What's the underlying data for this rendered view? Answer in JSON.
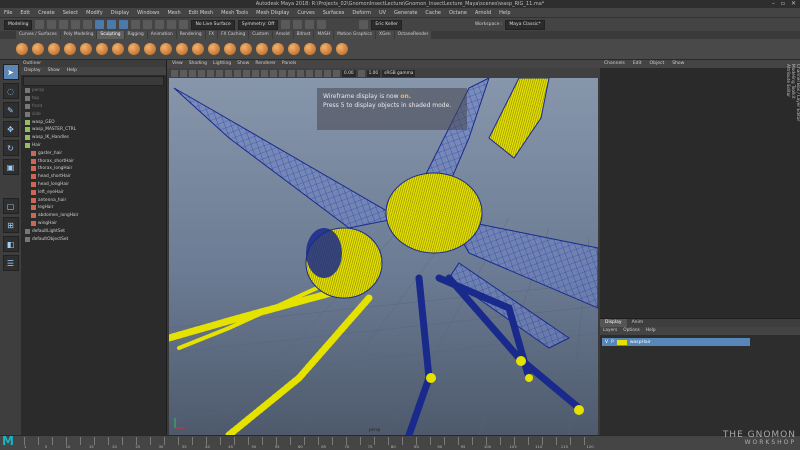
{
  "window": {
    "title": "Autodesk Maya 2018: R:\\Projects_02\\GnomonInsectLecture\\Gnomon_InsectLecture_Maya\\scenes\\wasp_RIG_11.ma*"
  },
  "menu": [
    "File",
    "Edit",
    "Create",
    "Select",
    "Modify",
    "Display",
    "Windows",
    "Mesh",
    "Edit Mesh",
    "Mesh Tools",
    "Mesh Display",
    "Curves",
    "Surfaces",
    "Deform",
    "UV",
    "Generate",
    "Cache",
    "Octane",
    "Arnold",
    "Help"
  ],
  "status": {
    "mode": "Modeling",
    "live_surface": "No Live Surface",
    "symmetry": "Symmetry: Off",
    "user": "Eric Keller",
    "workspace_label": "Workspace :",
    "workspace": "Maya Classic*"
  },
  "shelf_tabs": [
    "Curves / Surfaces",
    "Poly Modeling",
    "Sculpting",
    "Rigging",
    "Animation",
    "Rendering",
    "FX",
    "FX Caching",
    "Custom",
    "Arnold",
    "Bifrost",
    "MASH",
    "Motion Graphics",
    "XGen",
    "OctaneRender"
  ],
  "shelf_active": "Sculpting",
  "outliner": {
    "title": "Outliner",
    "menu": [
      "Display",
      "Show",
      "Help"
    ],
    "items": [
      {
        "label": "persp",
        "dim": true
      },
      {
        "label": "top",
        "dim": true
      },
      {
        "label": "front",
        "dim": true
      },
      {
        "label": "side",
        "dim": true
      },
      {
        "label": "wasp_GEO",
        "dim": false
      },
      {
        "label": "wasp_MASTER_CTRL",
        "dim": false
      },
      {
        "label": "wasp_IK_Handles",
        "dim": false
      },
      {
        "label": "Hair",
        "dim": false
      },
      {
        "label": "gaster_hair",
        "dim": false
      },
      {
        "label": "thorax_shortHair",
        "dim": false
      },
      {
        "label": "thorax_longHair",
        "dim": false
      },
      {
        "label": "head_shortHair",
        "dim": false
      },
      {
        "label": "head_longHair",
        "dim": false
      },
      {
        "label": "left_eyeHair",
        "dim": false
      },
      {
        "label": "antenna_hair",
        "dim": false
      },
      {
        "label": "legHair",
        "dim": false
      },
      {
        "label": "abdomen_longHair",
        "dim": false
      },
      {
        "label": "wingHair",
        "dim": false
      },
      {
        "label": "defaultLightSet",
        "dim": false
      },
      {
        "label": "defaultObjectSet",
        "dim": false
      }
    ]
  },
  "viewport": {
    "menu": [
      "View",
      "Shading",
      "Lighting",
      "Show",
      "Renderer",
      "Panels"
    ],
    "val1": "0.00",
    "val2": "1.00",
    "colorspace": "sRGB gamma",
    "camera": "persp",
    "message_line1_pre": "Wireframe display is now ",
    "message_on": "on.",
    "message_line2": "Press 5 to display objects in shaded mode."
  },
  "channelbox": {
    "menu": [
      "Channels",
      "Edit",
      "Object",
      "Show"
    ]
  },
  "layers": {
    "tabs": [
      "Display",
      "Anim"
    ],
    "menu": [
      "Layers",
      "Options",
      "Help"
    ],
    "layer_name": "waspHair",
    "layer_v": "V",
    "layer_p": "P"
  },
  "side_tabs": [
    "Channel Box / Layer Editor",
    "Modeling Toolkit",
    "Attribute Editor"
  ],
  "timeline": {
    "ticks": [
      "1",
      "5",
      "10",
      "15",
      "20",
      "25",
      "30",
      "35",
      "40",
      "45",
      "50",
      "55",
      "60",
      "65",
      "70",
      "75",
      "80",
      "85",
      "90",
      "95",
      "100",
      "105",
      "110",
      "115",
      "120"
    ]
  },
  "watermark": {
    "line1": "THE GNOMON",
    "line2": "WORKSHOP"
  },
  "maya_logo": "M",
  "colors": {
    "wire_blue": "#1a2a8c",
    "hair_yellow": "#e6e200",
    "layer_blue": "#5787b8",
    "accent_orange": "#f2c21b"
  }
}
